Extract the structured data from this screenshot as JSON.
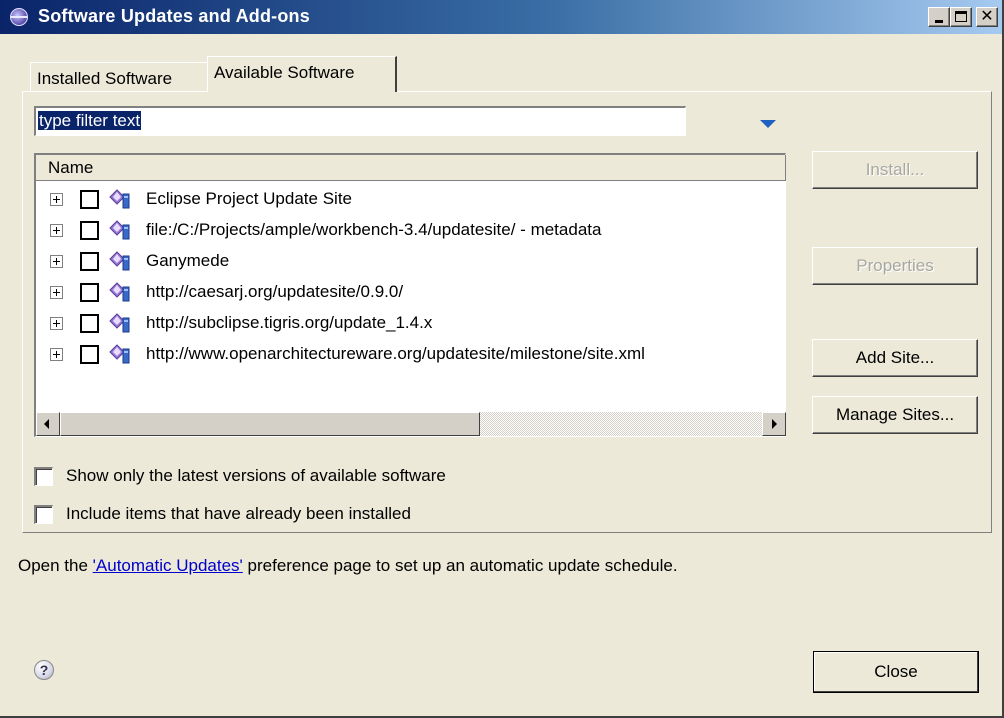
{
  "window": {
    "title": "Software Updates and Add-ons",
    "minimize": "_",
    "maximize": "□",
    "close": "✕"
  },
  "tabs": [
    {
      "label": "Installed Software",
      "selected": false
    },
    {
      "label": "Available Software",
      "selected": true
    }
  ],
  "filter": {
    "value": "type filter text"
  },
  "tree": {
    "column_header": "Name",
    "items": [
      {
        "label": "Eclipse Project Update Site",
        "icon": "update-site-icon",
        "checked": false
      },
      {
        "label": "file:/C:/Projects/ample/workbench-3.4/updatesite/ - metadata",
        "icon": "update-site-icon",
        "checked": false
      },
      {
        "label": "Ganymede",
        "icon": "update-site-icon",
        "checked": false
      },
      {
        "label": "http://caesarj.org/updatesite/0.9.0/",
        "icon": "update-site-icon",
        "checked": false
      },
      {
        "label": "http://subclipse.tigris.org/update_1.4.x",
        "icon": "update-site-icon",
        "checked": false
      },
      {
        "label": "http://www.openarchitectureware.org/updatesite/milestone/site.xml",
        "icon": "update-site-icon",
        "checked": false
      }
    ]
  },
  "buttons": {
    "install": "Install...",
    "properties": "Properties",
    "add_site": "Add Site...",
    "manage_sites": "Manage Sites...",
    "close": "Close"
  },
  "options": {
    "latest_versions": {
      "label": "Show only the latest versions of available software",
      "checked": false
    },
    "include_installed": {
      "label": "Include items that have already been installed",
      "checked": false
    }
  },
  "footer": {
    "prefix": "Open the ",
    "link": "'Automatic Updates'",
    "suffix": " preference page to set up an automatic update schedule."
  },
  "help": {
    "glyph": "?"
  },
  "colors": {
    "titlebar_start": "#0a246a",
    "titlebar_end": "#a6caf0",
    "dialog_bg": "#ece9d8",
    "selection": "#0a246a",
    "link": "#0000cc"
  }
}
